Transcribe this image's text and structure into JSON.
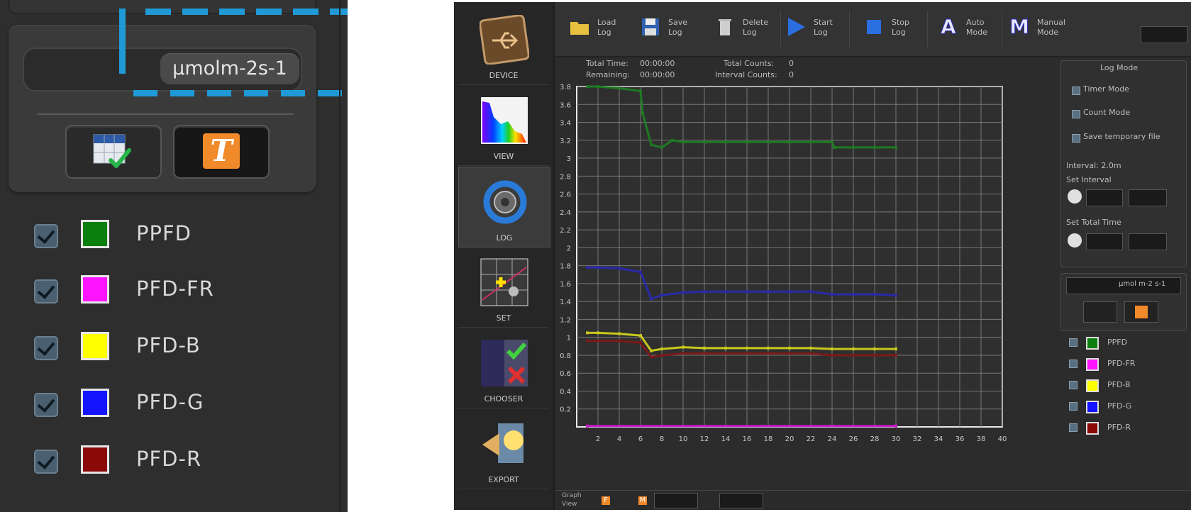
{
  "zoom": {
    "unit": "µmolm-2s-1",
    "buttons": [
      {
        "name": "table-view-button",
        "icon": "table-check-icon"
      },
      {
        "name": "text-view-button",
        "icon": "text-t-icon",
        "glyph": "T"
      }
    ],
    "legend": [
      {
        "label": "PPFD",
        "color": "#0a7f10",
        "checked": true
      },
      {
        "label": "PFD-FR",
        "color": "#ff14ff",
        "checked": true
      },
      {
        "label": "PFD-B",
        "color": "#ffff00",
        "checked": true
      },
      {
        "label": "PFD-G",
        "color": "#1414ff",
        "checked": true
      },
      {
        "label": "PFD-R",
        "color": "#8a0a0a",
        "checked": true
      }
    ]
  },
  "app": {
    "nav": [
      {
        "label": "DEVICE",
        "icon": "usb-device-icon"
      },
      {
        "label": "VIEW",
        "icon": "spectrum-icon"
      },
      {
        "label": "LOG",
        "icon": "log-refresh-icon",
        "active": true
      },
      {
        "label": "SET",
        "icon": "calibrate-icon"
      },
      {
        "label": "CHOOSER",
        "icon": "chooser-icon"
      },
      {
        "label": "EXPORT",
        "icon": "export-lightbulb-icon"
      }
    ],
    "toolbar": [
      {
        "label": "Load\nLog",
        "icon": "folder-icon"
      },
      {
        "label": "Save\nLog",
        "icon": "floppy-icon"
      },
      {
        "label": "Delete\nLog",
        "icon": "trash-icon"
      },
      {
        "label": "Start\nLog",
        "icon": "play-icon"
      },
      {
        "label": "Stop\nLog",
        "icon": "stop-icon"
      },
      {
        "label": "Auto\nMode",
        "icon": "auto-mode-icon",
        "glyph": "A"
      },
      {
        "label": "Manual\nMode",
        "icon": "manual-mode-icon",
        "glyph": "M"
      }
    ],
    "info": {
      "total_time_label": "Total Time:",
      "total_time": "00:00:00",
      "remaining_label": "Remaining:",
      "remaining": "00:00:00",
      "total_counts_label": "Total Counts:",
      "total_counts": "0",
      "interval_counts_label": "Interval Counts:",
      "interval_counts": "0"
    },
    "right_panel": {
      "title": "Log Mode",
      "opt1": "Timer Mode",
      "opt2": "Count Mode",
      "opt3": "Save temporary file",
      "interval_label": "Interval: 2.0m",
      "set_interval": "Set Interval",
      "set_total": "Set Total Time",
      "unit_short": "µmol m-2 s-1",
      "legend": [
        "PPFD",
        "PFD-FR",
        "PFD-B",
        "PFD-G",
        "PFD-R"
      ]
    },
    "bottom": {
      "label": "Graph\nView",
      "f": "F",
      "m": "M"
    }
  },
  "chart_data": {
    "type": "line",
    "xlim": [
      0,
      40
    ],
    "ylim": [
      0,
      3.8
    ],
    "xticks": [
      2,
      4,
      6,
      8,
      10,
      12,
      14,
      16,
      18,
      20,
      22,
      24,
      26,
      28,
      30,
      32,
      34,
      36,
      38,
      40
    ],
    "yticks": [
      0.2,
      0.4,
      0.6,
      0.8,
      1,
      1.2,
      1.4,
      1.6,
      1.8,
      2,
      2.2,
      2.4,
      2.6,
      2.8,
      3,
      3.2,
      3.4,
      3.6,
      3.8
    ],
    "xtick_labels": [
      "2",
      "4",
      "6",
      "8",
      "10",
      "12",
      "14",
      "16",
      "18",
      "20",
      "22",
      "24",
      "26",
      "28",
      "30",
      "32",
      "34",
      "36",
      "38",
      "40"
    ],
    "ytick_labels": [
      "0.2",
      "0.4",
      "0.6",
      "0.8",
      "1",
      "1.2",
      "1.4",
      "1.6",
      "1.8",
      "2",
      "2.2",
      "2.4",
      "2.6",
      "2.8",
      "3",
      "3.2",
      "3.4",
      "3.6",
      "3.8"
    ],
    "grid": true,
    "series": [
      {
        "color": "#1e7a22",
        "x": [
          1,
          2,
          4,
          6,
          6.2,
          7,
          8,
          9,
          10,
          12,
          14,
          16,
          18,
          20,
          22,
          24,
          24.2,
          26,
          28,
          30
        ],
        "y": [
          3.8,
          3.8,
          3.78,
          3.75,
          3.5,
          3.15,
          3.12,
          3.2,
          3.18,
          3.18,
          3.18,
          3.18,
          3.18,
          3.18,
          3.18,
          3.18,
          3.12,
          3.12,
          3.12,
          3.12
        ]
      },
      {
        "color": "#2a2aa8",
        "x": [
          1,
          2,
          4,
          6,
          7,
          8,
          10,
          12,
          14,
          16,
          18,
          20,
          22,
          24,
          26,
          28,
          30
        ],
        "y": [
          1.78,
          1.78,
          1.77,
          1.73,
          1.43,
          1.47,
          1.5,
          1.51,
          1.51,
          1.51,
          1.51,
          1.51,
          1.51,
          1.48,
          1.48,
          1.48,
          1.47
        ]
      },
      {
        "color": "#c8c81e",
        "x": [
          1,
          2,
          4,
          6,
          7,
          8,
          10,
          12,
          14,
          16,
          18,
          20,
          22,
          24,
          26,
          28,
          30
        ],
        "y": [
          1.05,
          1.05,
          1.04,
          1.02,
          0.85,
          0.87,
          0.89,
          0.88,
          0.88,
          0.88,
          0.88,
          0.88,
          0.88,
          0.87,
          0.87,
          0.87,
          0.87
        ]
      },
      {
        "color": "#7a1a1a",
        "x": [
          1,
          2,
          4,
          6,
          7,
          8,
          10,
          12,
          14,
          16,
          18,
          20,
          22,
          24,
          26,
          28,
          30
        ],
        "y": [
          0.96,
          0.96,
          0.96,
          0.94,
          0.78,
          0.8,
          0.82,
          0.82,
          0.82,
          0.82,
          0.82,
          0.82,
          0.82,
          0.8,
          0.8,
          0.8,
          0.8
        ]
      },
      {
        "color": "#c81ec8",
        "x": [
          1,
          30
        ],
        "y": [
          0.01,
          0.01
        ]
      }
    ]
  }
}
